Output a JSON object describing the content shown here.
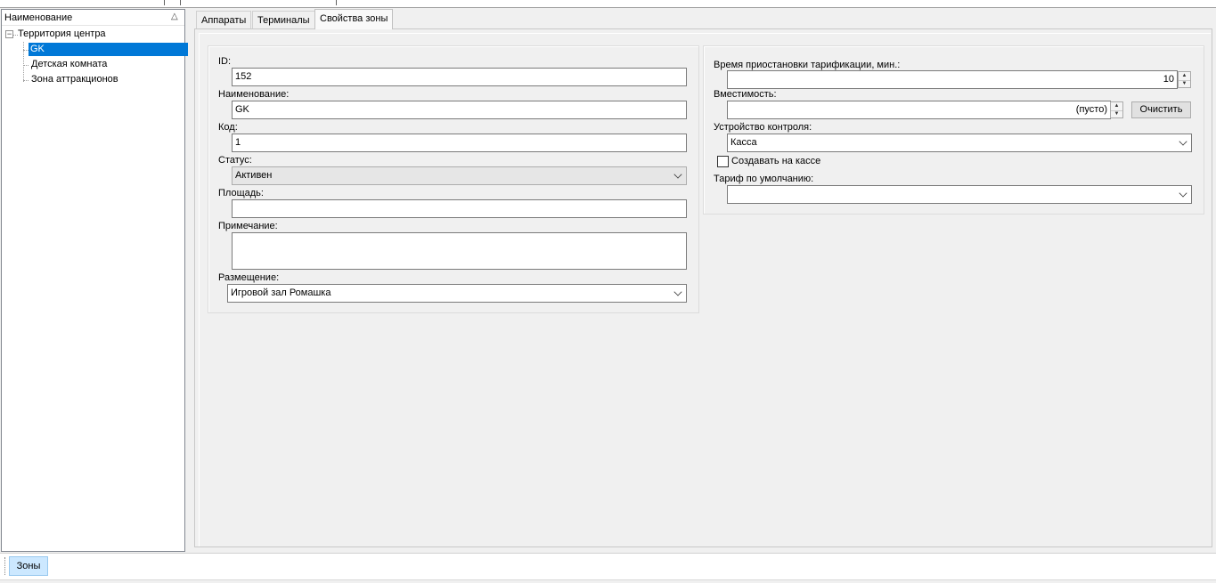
{
  "tree": {
    "header": "Наименование",
    "sort_icon": "sort-ascending-icon",
    "nodes": [
      {
        "label": "Территория центра",
        "expander": "⊟"
      },
      {
        "label": "GK"
      },
      {
        "label": "Детская комната"
      },
      {
        "label": "Зона аттракционов"
      }
    ]
  },
  "tabs": [
    "Аппараты",
    "Терминалы",
    "Свойства зоны"
  ],
  "left_group": {
    "id_label": "ID:",
    "id_value": "152",
    "name_label": "Наименование:",
    "name_value": "GK",
    "code_label": "Код:",
    "code_value": "1",
    "status_label": "Статус:",
    "status_value": "Активен",
    "area_label": "Площадь:",
    "area_value": "",
    "note_label": "Примечание:",
    "note_value": "",
    "placement_label": "Размещение:",
    "placement_value": "Игровой зал Ромашка"
  },
  "right_group": {
    "pause_label": "Время приостановки тарификации, мин.:",
    "pause_value": "10",
    "capacity_label": "Вместимость:",
    "capacity_value": "(пусто)",
    "clear_button": "Очистить",
    "device_label": "Устройство контроля:",
    "device_value": "Касса",
    "create_at_cashier_label": "Создавать на кассе",
    "create_at_cashier_checked": false,
    "default_tariff_label": "Тариф по умолчанию:",
    "default_tariff_value": ""
  },
  "bottom": {
    "zones_button": "Зоны"
  }
}
